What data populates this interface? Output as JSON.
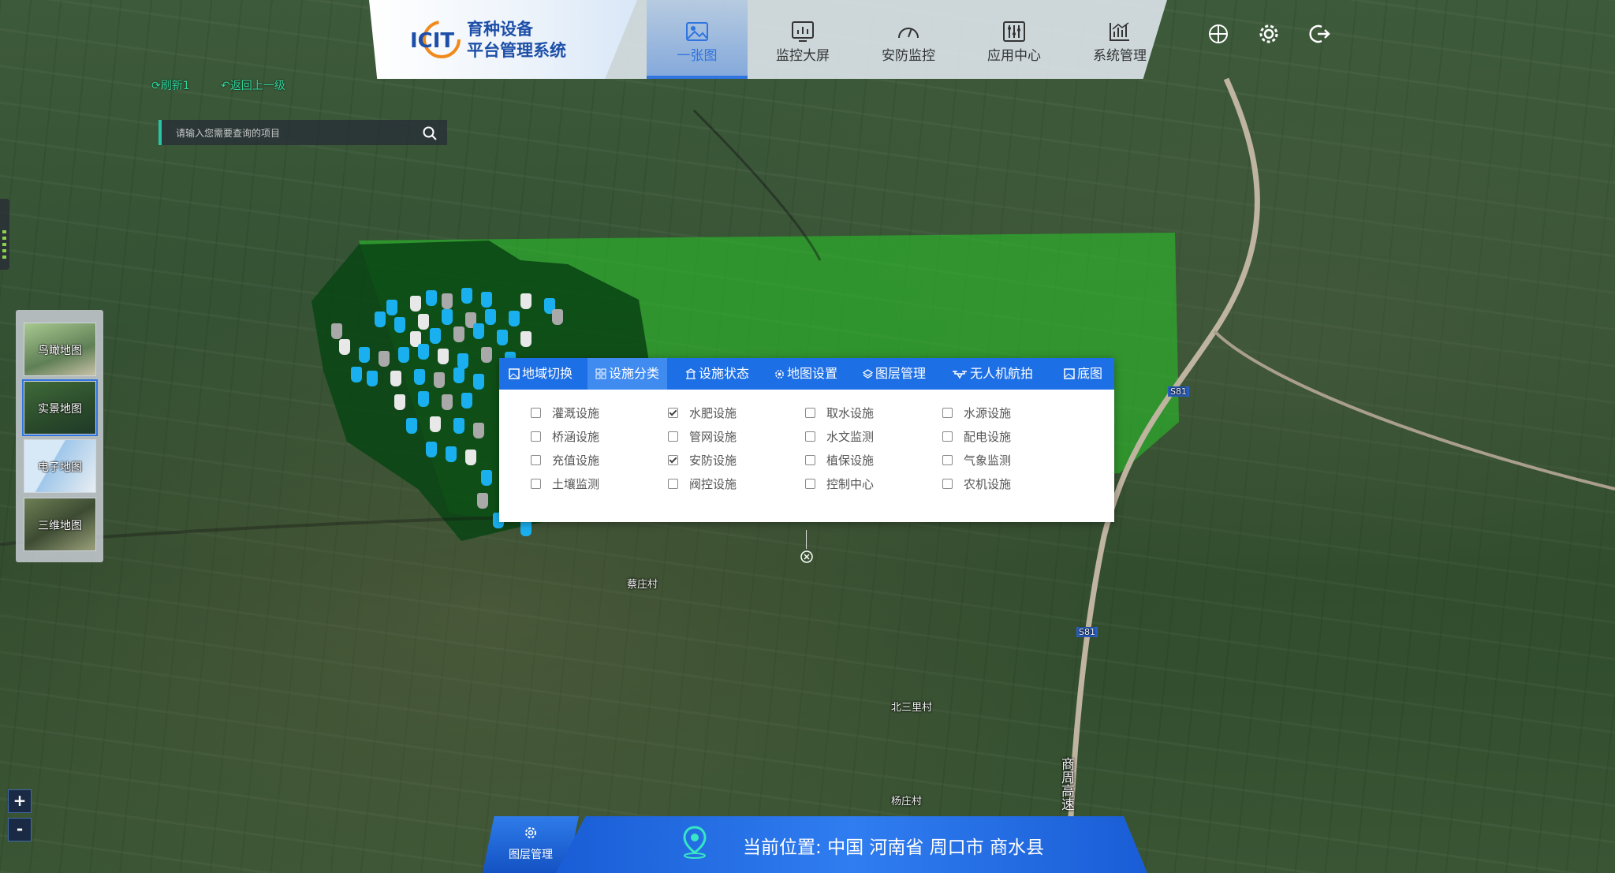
{
  "app": {
    "logo_text": "ICIT",
    "title_line1": "育种设备",
    "title_line2": "平台管理系统"
  },
  "nav": {
    "items": [
      {
        "label": "一张图",
        "icon": "image-icon",
        "active": true
      },
      {
        "label": "监控大屏",
        "icon": "dashboard-icon",
        "active": false
      },
      {
        "label": "安防监控",
        "icon": "gauge-icon",
        "active": false
      },
      {
        "label": "应用中心",
        "icon": "sliders-icon",
        "active": false
      },
      {
        "label": "系统管理",
        "icon": "chart-icon",
        "active": false
      }
    ],
    "right_icons": [
      "compass-icon",
      "gear-icon",
      "logout-icon"
    ]
  },
  "toolbar": {
    "refresh_label": "刷新1",
    "back_label": "返回上一级"
  },
  "search": {
    "placeholder": "请输入您需要查询的项目"
  },
  "map_types": [
    {
      "label": "鸟瞰地图",
      "active": false
    },
    {
      "label": "实景地图",
      "active": true
    },
    {
      "label": "电子地图",
      "active": false
    },
    {
      "label": "三维地图",
      "active": false
    }
  ],
  "zoom": {
    "in": "+",
    "out": "-"
  },
  "panel": {
    "tabs": [
      {
        "label": "地域切换",
        "icon": "image-icon"
      },
      {
        "label": "设施分类",
        "icon": "grid-icon",
        "active": true
      },
      {
        "label": "设施状态",
        "icon": "building-icon"
      },
      {
        "label": "地图设置",
        "icon": "gear-icon"
      },
      {
        "label": "图层管理",
        "icon": "layers-icon"
      },
      {
        "label": "无人机航拍",
        "icon": "drone-icon"
      },
      {
        "label": "底图",
        "icon": "image-icon"
      }
    ],
    "options": [
      {
        "label": "灌溉设施",
        "checked": false
      },
      {
        "label": "水肥设施",
        "checked": true
      },
      {
        "label": "取水设施",
        "checked": false
      },
      {
        "label": "水源设施",
        "checked": false
      },
      {
        "label": "桥涵设施",
        "checked": false
      },
      {
        "label": "管网设施",
        "checked": false
      },
      {
        "label": "水文监测",
        "checked": false
      },
      {
        "label": "配电设施",
        "checked": false
      },
      {
        "label": "充值设施",
        "checked": false
      },
      {
        "label": "安防设施",
        "checked": true
      },
      {
        "label": "植保设施",
        "checked": false
      },
      {
        "label": "气象监测",
        "checked": false
      },
      {
        "label": "土壤监测",
        "checked": false
      },
      {
        "label": "阀控设施",
        "checked": false
      },
      {
        "label": "控制中心",
        "checked": false
      },
      {
        "label": "农机设施",
        "checked": false
      }
    ]
  },
  "bottom": {
    "layer_label": "图层管理",
    "location_prefix": "当前位置:",
    "location": "中国 河南省 周口市 商水县"
  },
  "map_labels": [
    "蔡庄村",
    "北三里村",
    "杨庄村",
    "商周高速",
    "S81",
    "S81"
  ]
}
